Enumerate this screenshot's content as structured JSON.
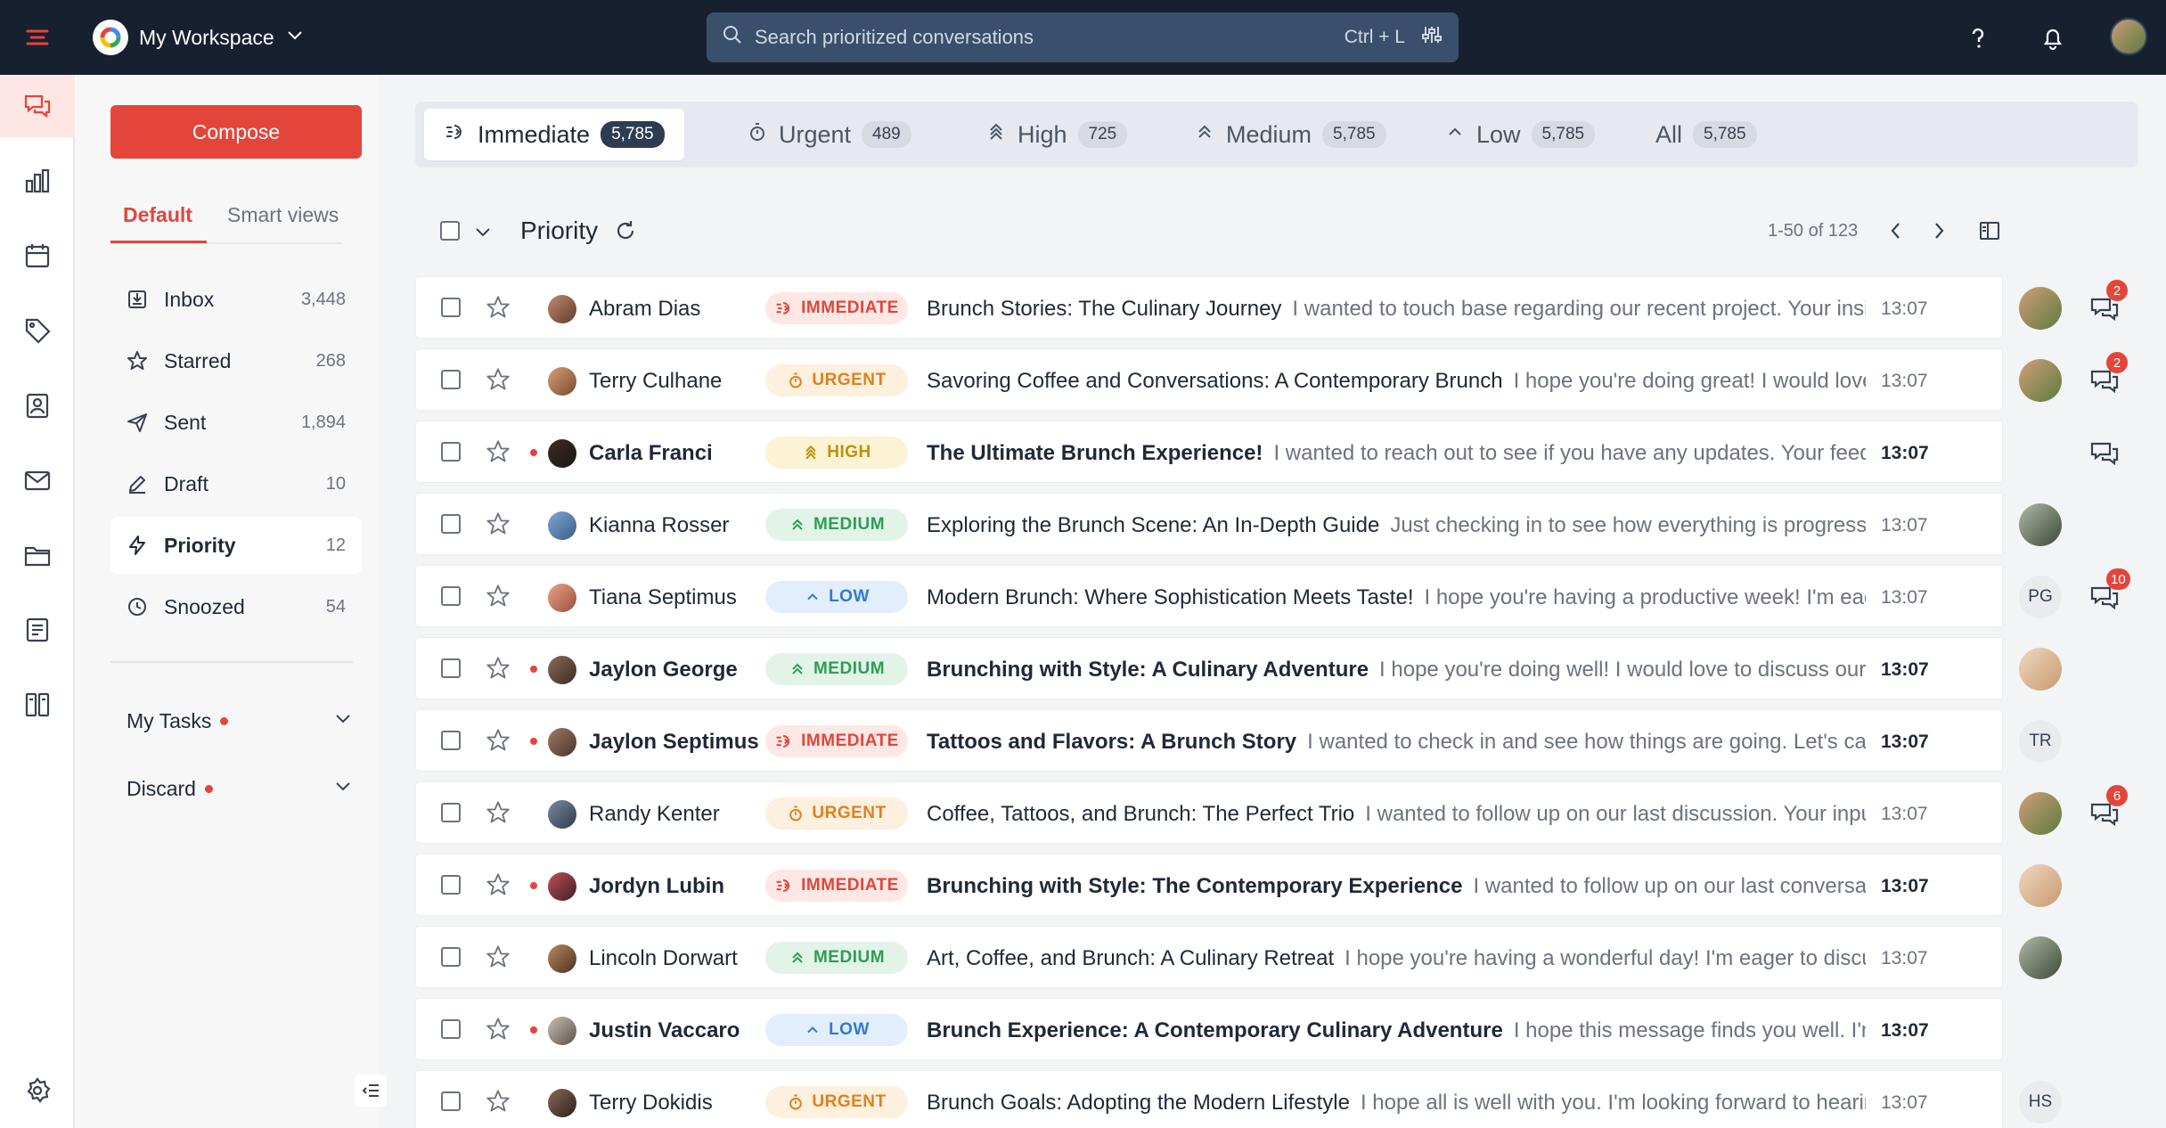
{
  "workspace": {
    "name": "My Workspace"
  },
  "search": {
    "placeholder": "Search prioritized conversations",
    "shortcut": "Ctrl + L"
  },
  "sidebar": {
    "compose_label": "Compose",
    "tabs": [
      {
        "label": "Default"
      },
      {
        "label": "Smart views"
      }
    ],
    "folders": [
      {
        "label": "Inbox",
        "count": "3,448"
      },
      {
        "label": "Starred",
        "count": "268"
      },
      {
        "label": "Sent",
        "count": "1,894"
      },
      {
        "label": "Draft",
        "count": "10"
      },
      {
        "label": "Priority",
        "count": "12"
      },
      {
        "label": "Snoozed",
        "count": "54"
      }
    ],
    "groups": [
      {
        "label": "My Tasks"
      },
      {
        "label": "Discard"
      }
    ]
  },
  "priority_tabs": [
    {
      "label": "Immediate",
      "count": "5,785"
    },
    {
      "label": "Urgent",
      "count": "489"
    },
    {
      "label": "High",
      "count": "725"
    },
    {
      "label": "Medium",
      "count": "5,785"
    },
    {
      "label": "Low",
      "count": "5,785"
    },
    {
      "label": "All",
      "count": "5,785"
    }
  ],
  "list": {
    "title": "Priority",
    "pager": "1-50 of 123"
  },
  "badges": {
    "immediate": "IMMEDIATE",
    "urgent": "URGENT",
    "high": "HIGH",
    "medium": "MEDIUM",
    "low": "LOW"
  },
  "rows": [
    {
      "sender": "Abram Dias",
      "priority": "immediate",
      "subject": "Brunch Stories: The Culinary Journey",
      "preview": "I wanted to touch base regarding our recent project. Your insights would be valuable.",
      "time": "13:07",
      "assignee": "",
      "chat_count": "2"
    },
    {
      "sender": "Terry Culhane",
      "priority": "urgent",
      "subject": "Savoring Coffee and Conversations: A Contemporary Brunch",
      "preview": "I hope you're doing great! I would love to hear from you.",
      "time": "13:07",
      "assignee": "",
      "chat_count": "2"
    },
    {
      "sender": "Carla Franci",
      "priority": "high",
      "subject": "The Ultimate Brunch Experience!",
      "preview": "I wanted to reach out to see if you have any updates. Your feedback is always welcome.",
      "time": "13:07",
      "assignee": "",
      "chat_count": ""
    },
    {
      "sender": "Kianna Rosser",
      "priority": "medium",
      "subject": "Exploring the Brunch Scene: An In-Depth Guide",
      "preview": "Just checking in to see how everything is progressing. Let me know.",
      "time": "13:07",
      "assignee": "",
      "chat_count": ""
    },
    {
      "sender": "Tiana Septimus",
      "priority": "low",
      "subject": "Modern Brunch: Where Sophistication Meets Taste!",
      "preview": "I hope you're having a productive week! I'm eager to hear from you.",
      "time": "13:07",
      "assignee": "PG",
      "chat_count": "10"
    },
    {
      "sender": "Jaylon George",
      "priority": "medium",
      "subject": "Brunching with Style: A Culinary Adventure",
      "preview": "I hope you're doing well! I would love to discuss our project further.",
      "time": "13:07",
      "assignee": "",
      "chat_count": ""
    },
    {
      "sender": "Jaylon Septimus",
      "priority": "immediate",
      "subject": "Tattoos and Flavors: A Brunch Story",
      "preview": "I wanted to check in and see how things are going. Let's catch up soon!",
      "time": "13:07",
      "assignee": "TR",
      "chat_count": ""
    },
    {
      "sender": "Randy Kenter",
      "priority": "urgent",
      "subject": "Coffee, Tattoos, and Brunch: The Perfect Trio",
      "preview": "I wanted to follow up on our last discussion. Your input would be great.",
      "time": "13:07",
      "assignee": "",
      "chat_count": "6"
    },
    {
      "sender": "Jordyn Lubin",
      "priority": "immediate",
      "subject": "Brunching with Style: The Contemporary Experience",
      "preview": "I wanted to follow up on our last conversation. It would be great to hear back.",
      "time": "13:07",
      "assignee": "",
      "chat_count": ""
    },
    {
      "sender": "Lincoln Dorwart",
      "priority": "medium",
      "subject": "Art, Coffee, and Brunch: A Culinary Retreat",
      "preview": "I hope you're having a wonderful day! I'm eager to discuss our upcoming plans.",
      "time": "13:07",
      "assignee": "",
      "chat_count": ""
    },
    {
      "sender": "Justin Vaccaro",
      "priority": "low",
      "subject": "Brunch Experience: A Contemporary Culinary Adventure",
      "preview": "I hope this message finds you well. I'm reaching out about our plans.",
      "time": "13:07",
      "assignee": "",
      "chat_count": ""
    },
    {
      "sender": "Terry Dokidis",
      "priority": "urgent",
      "subject": "Brunch Goals: Adopting the Modern Lifestyle",
      "preview": "I hope all is well with you. I'm looking forward to hearing your thoughts.",
      "time": "13:07",
      "assignee": "HS",
      "chat_count": ""
    }
  ],
  "colors": {
    "accent": "#e4453a",
    "topbar": "#16202f"
  }
}
